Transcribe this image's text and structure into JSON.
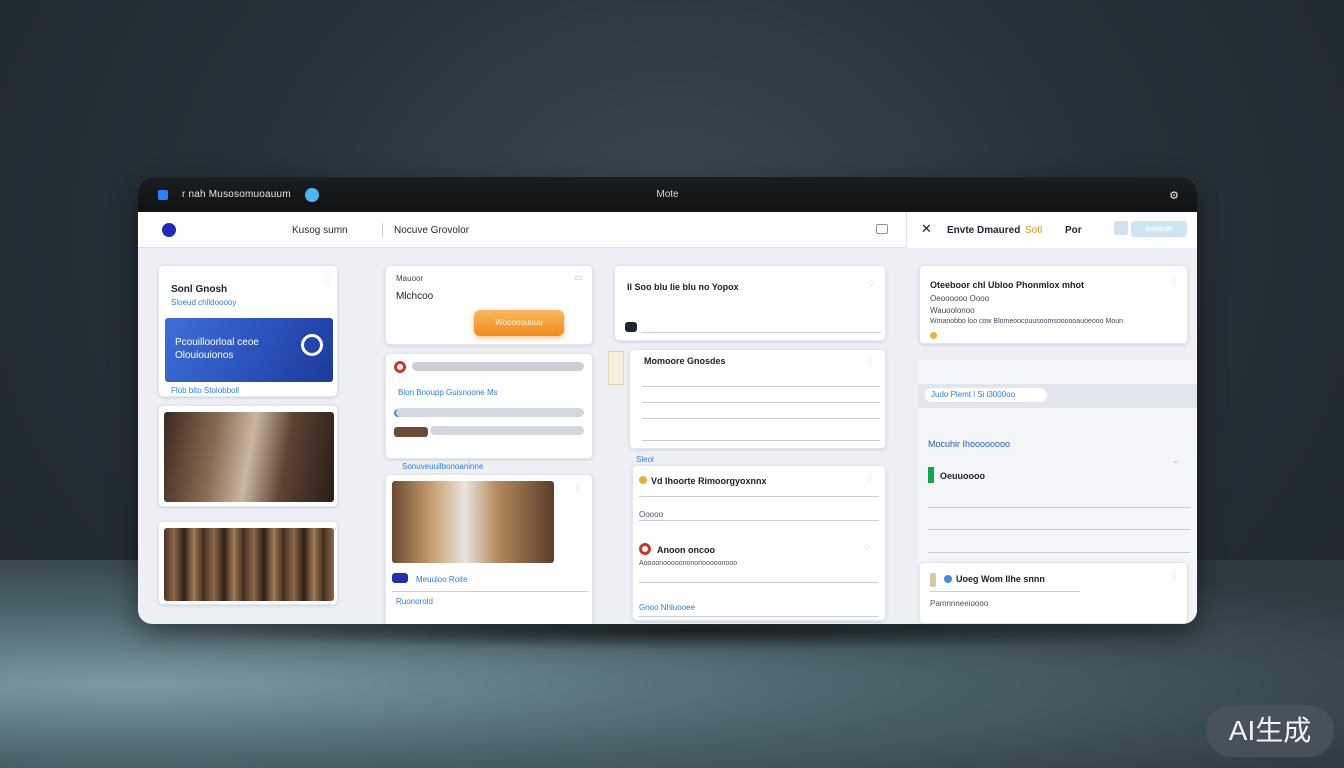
{
  "titlebar": {
    "title": "r nah Musosomuoauum",
    "center": "Mote",
    "right_icon": "settings-icon"
  },
  "toolbar": {
    "left_label": "Kusog sumn",
    "mid_label": "Nocuve Grovolor",
    "right_title": "Envte Dmaured",
    "right_title_accent": "Sotl",
    "right_short": "Por",
    "search_text": "aaaaae"
  },
  "col1": {
    "card_title": "Sonl Gnosh",
    "card_sub": "Sloeud chlldooooy",
    "promo_text_1": "Pcouilloorloal ceoe",
    "promo_text_2": "Olouiouionos",
    "caption": "Flob blto Stolobboll"
  },
  "col2": {
    "card1_title": "Mauoor",
    "card1_sub": "Mlchcoo",
    "card1_button": "Wooooouuuu",
    "card2_link": "Blon Bnoupp Guisnoone Ms",
    "caption": "Sonuveuuilbonoaninne",
    "card3_row": "Meuuloo Roite",
    "card3_footer": "Ruonorold"
  },
  "col3": {
    "card1_title": "Il Soo blu lie blu no Yopox",
    "card2_title": "Momoore Gnosdes",
    "group_label": "Sleol",
    "card3_title": "Vd Ihoorte Rimoorgyoxnnx",
    "card3_row": "Ooooo",
    "card4_title": "Anoon oncoo",
    "card4_row": "Aoooonooooonononooooonooo",
    "card5_title": "Gnoo Nhluooee"
  },
  "col4": {
    "card_title": "Oteeboor chl Ubloo Phonmlox mhot",
    "card_line1": "Oeoooooo Oooo",
    "card_line2": "Wauoolonoo",
    "card_line3": "Wmanobbo loo cow Blomeoocouusoomsoooooauoeooo Moun",
    "chip": "Judo Plemt l Si l3000oo",
    "section_title": "Mocuhir Ihoooooooo",
    "row1": "Oeuuoooo",
    "card2_title": "Uoeg Wom Ilhe snnn",
    "card2_row": "Pamnnneeioooo"
  },
  "watermark": "AI生成"
}
